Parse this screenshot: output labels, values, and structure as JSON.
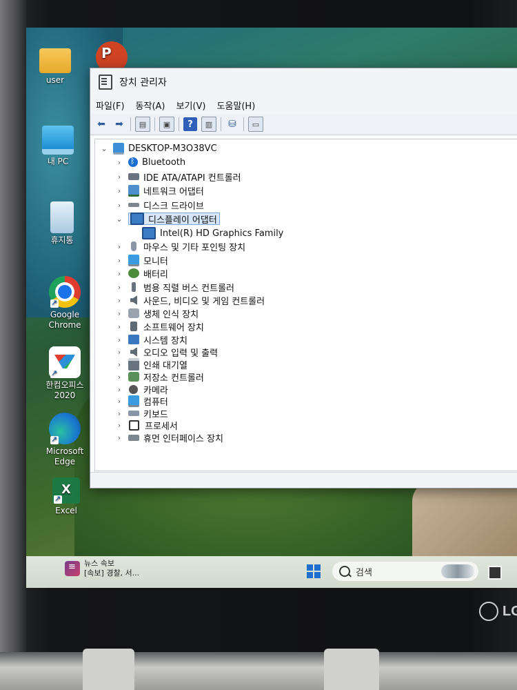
{
  "window": {
    "title": "장치 관리자",
    "menu": [
      "파일(F)",
      "동작(A)",
      "보기(V)",
      "도움말(H)"
    ]
  },
  "tree": {
    "root": "DESKTOP-M3O38VC",
    "categories": [
      {
        "label": "Bluetooth",
        "icon": "bluetooth-icon",
        "expanded": false
      },
      {
        "label": "IDE ATA/ATAPI 컨트롤러",
        "icon": "ide-controller-icon",
        "expanded": false
      },
      {
        "label": "네트워크 어댑터",
        "icon": "network-adapter-icon",
        "expanded": false
      },
      {
        "label": "디스크 드라이브",
        "icon": "disk-drive-icon",
        "expanded": false
      },
      {
        "label": "디스플레이 어댑터",
        "icon": "display-adapter-icon",
        "expanded": true,
        "selected": true,
        "children": [
          {
            "label": "Intel(R) HD Graphics Family",
            "icon": "display-adapter-icon"
          }
        ]
      },
      {
        "label": "마우스 및 기타 포인팅 장치",
        "icon": "mouse-icon",
        "expanded": false
      },
      {
        "label": "모니터",
        "icon": "monitor-icon",
        "expanded": false
      },
      {
        "label": "배터리",
        "icon": "battery-icon",
        "expanded": false
      },
      {
        "label": "범용 직렬 버스 컨트롤러",
        "icon": "usb-icon",
        "expanded": false
      },
      {
        "label": "사운드, 비디오 및 게임 컨트롤러",
        "icon": "sound-icon",
        "expanded": false
      },
      {
        "label": "생체 인식 장치",
        "icon": "biometric-icon",
        "expanded": false
      },
      {
        "label": "소프트웨어 장치",
        "icon": "software-device-icon",
        "expanded": false
      },
      {
        "label": "시스템 장치",
        "icon": "system-device-icon",
        "expanded": false
      },
      {
        "label": "오디오 입력 및 출력",
        "icon": "audio-io-icon",
        "expanded": false
      },
      {
        "label": "인쇄 대기열",
        "icon": "print-queue-icon",
        "expanded": false
      },
      {
        "label": "저장소 컨트롤러",
        "icon": "storage-controller-icon",
        "expanded": false
      },
      {
        "label": "카메라",
        "icon": "camera-icon",
        "expanded": false
      },
      {
        "label": "컴퓨터",
        "icon": "computer-icon",
        "expanded": false
      },
      {
        "label": "키보드",
        "icon": "keyboard-icon",
        "expanded": false
      },
      {
        "label": "프로세서",
        "icon": "processor-icon",
        "expanded": false
      },
      {
        "label": "휴먼 인터페이스 장치",
        "icon": "hid-icon",
        "expanded": false
      }
    ]
  },
  "desktop": {
    "icons": [
      {
        "label": "user",
        "icon": "folder-icon"
      },
      {
        "label": "내 PC",
        "icon": "this-pc-icon"
      },
      {
        "label": "휴지통",
        "icon": "recycle-bin-icon"
      },
      {
        "label": "Google Chrome",
        "icon": "chrome-icon"
      },
      {
        "label": "한컴오피스 2020",
        "icon": "hancom-office-icon"
      },
      {
        "label": "Microsoft Edge",
        "icon": "edge-icon"
      },
      {
        "label": "Excel",
        "icon": "excel-icon"
      },
      {
        "label": "",
        "icon": "powerpoint-icon"
      }
    ]
  },
  "taskbar": {
    "news_title": "뉴스 속보",
    "news_text": "[속보] 경찰, 서...",
    "search_placeholder": "검색"
  },
  "device": {
    "brand": "LG"
  }
}
